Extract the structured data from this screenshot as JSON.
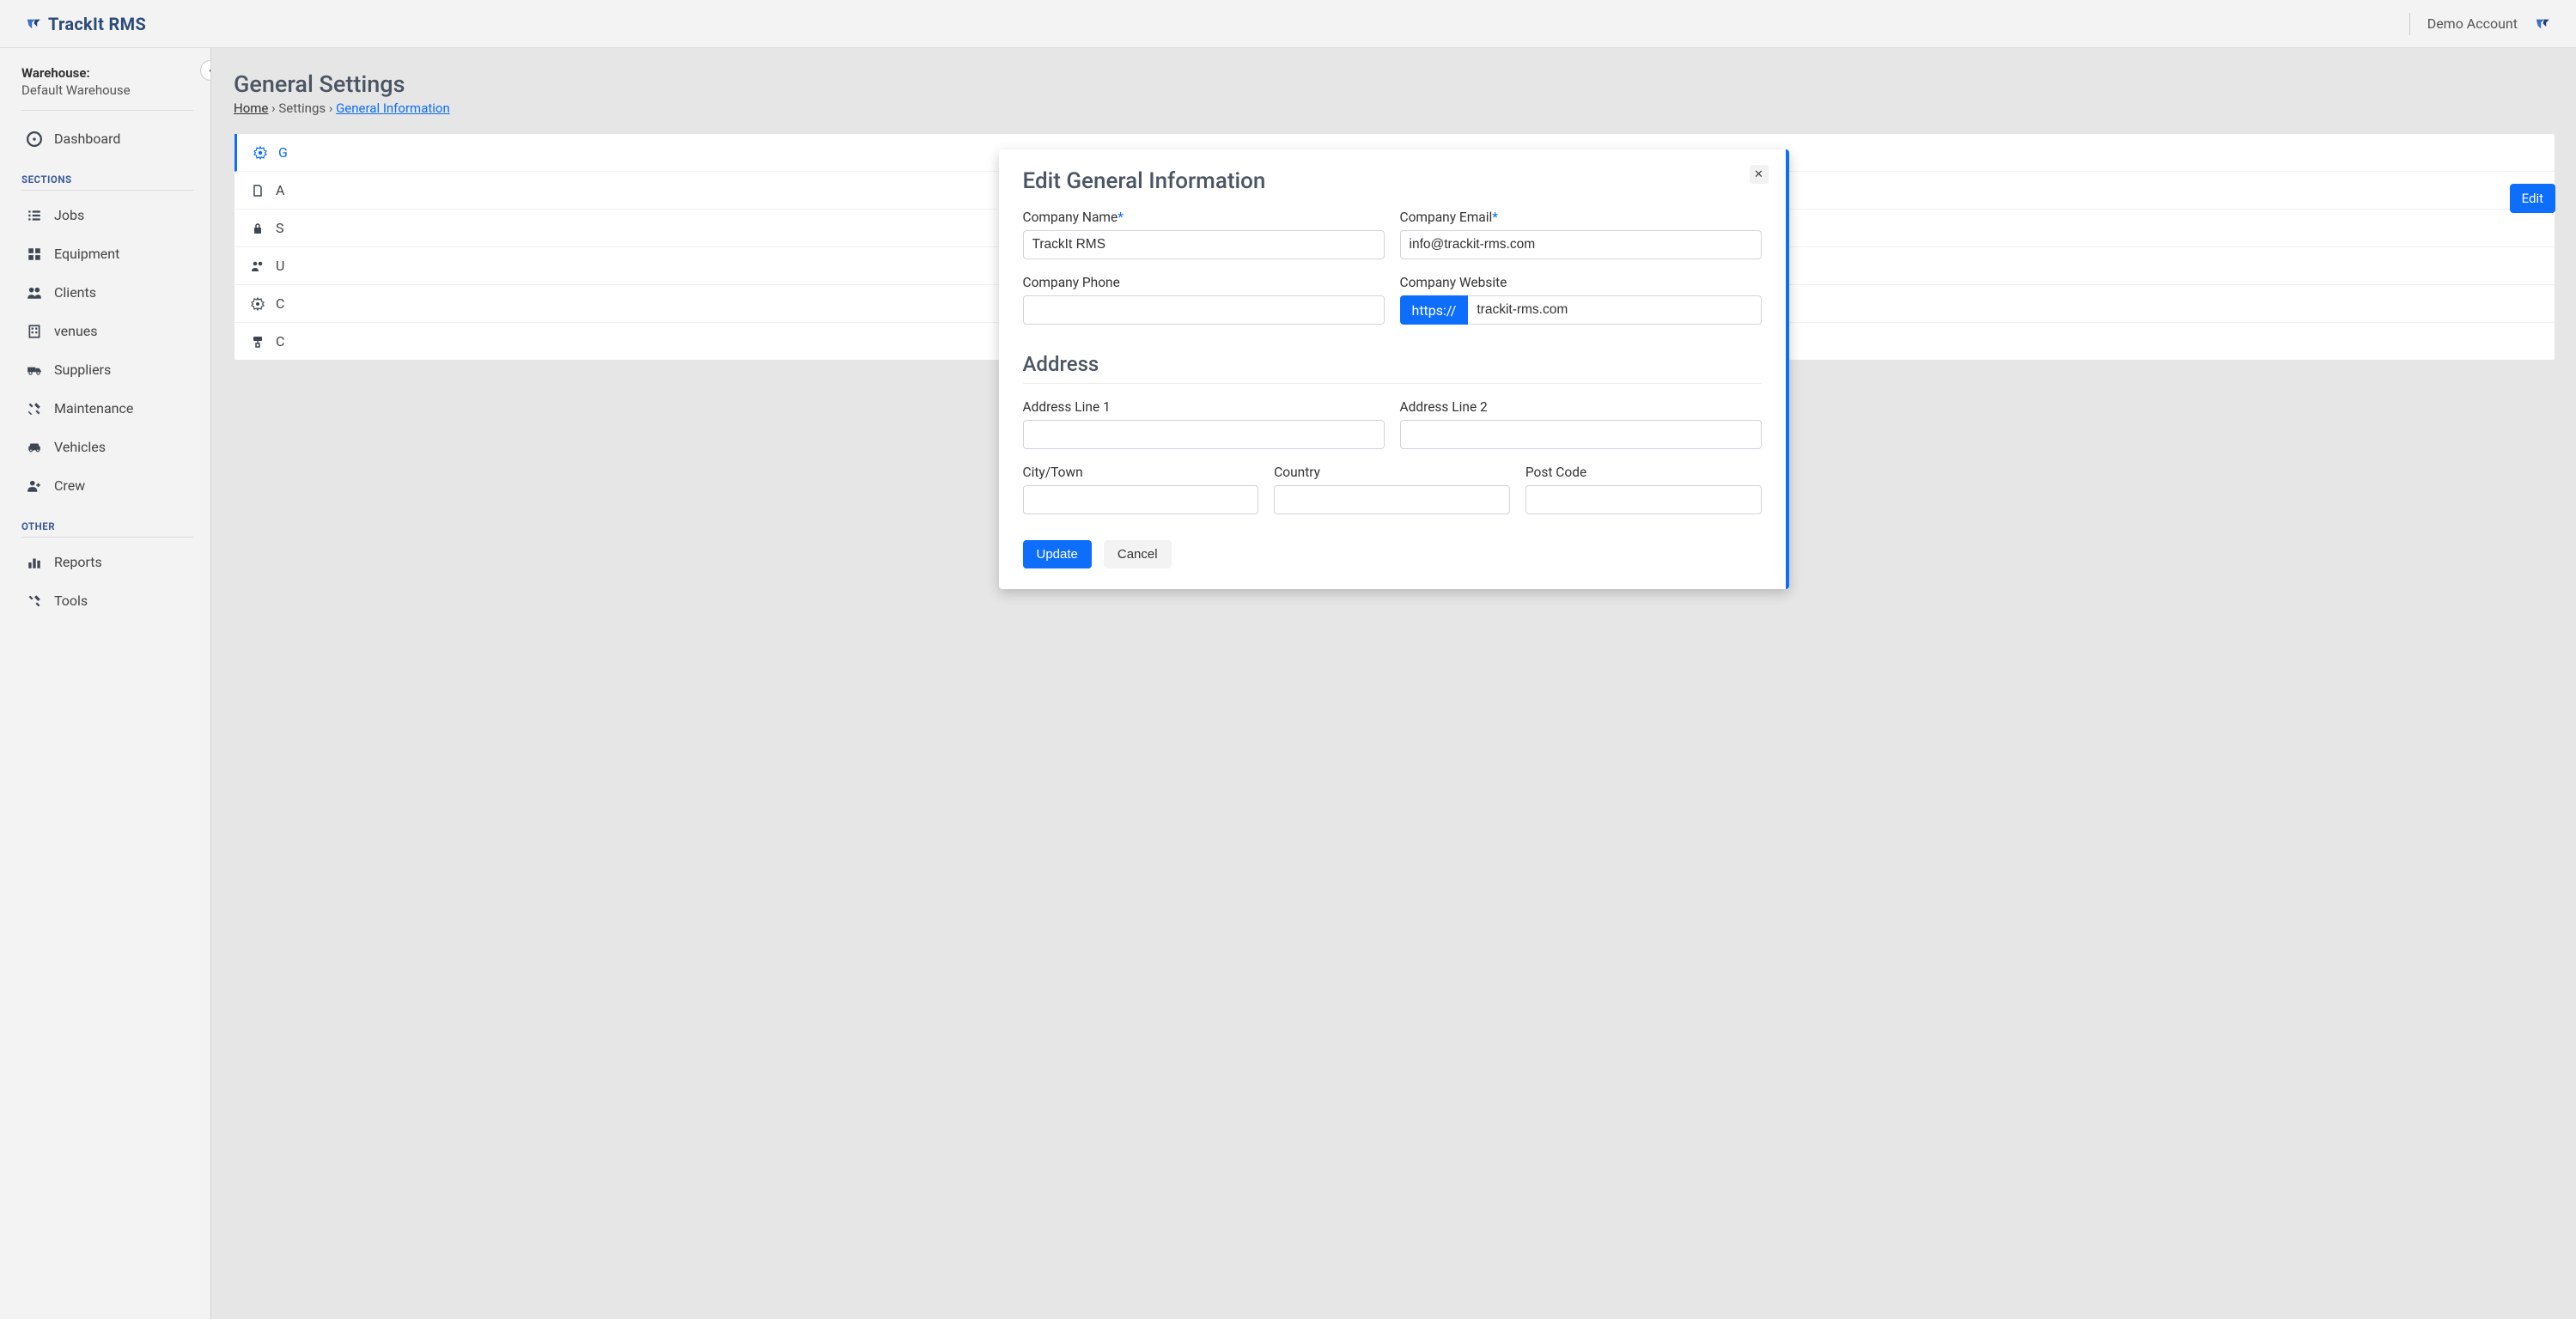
{
  "header": {
    "brand": "TrackIt RMS",
    "account": "Demo Account"
  },
  "sidebar": {
    "warehouse_label": "Warehouse:",
    "warehouse_value": "Default Warehouse",
    "items_main": [
      {
        "label": "Dashboard",
        "icon": "gauge"
      }
    ],
    "sections_heading": "Sections",
    "sections_items": [
      {
        "label": "Jobs",
        "icon": "list"
      },
      {
        "label": "Equipment",
        "icon": "boxes"
      },
      {
        "label": "Clients",
        "icon": "users"
      },
      {
        "label": "venues",
        "icon": "building"
      },
      {
        "label": "Suppliers",
        "icon": "truck"
      },
      {
        "label": "Maintenance",
        "icon": "wrench"
      },
      {
        "label": "Vehicles",
        "icon": "car"
      },
      {
        "label": "Crew",
        "icon": "user-plus"
      }
    ],
    "other_heading": "Other",
    "other_items": [
      {
        "label": "Reports",
        "icon": "chart-bar"
      },
      {
        "label": "Tools",
        "icon": "wrench-screw"
      }
    ]
  },
  "page": {
    "title": "General Settings",
    "breadcrumb": {
      "home": "Home",
      "settings": "Settings",
      "current": "General Information"
    },
    "edit_button": "Edit"
  },
  "settings_tabs": [
    {
      "label": "G",
      "icon": "gear",
      "active": true
    },
    {
      "label": "A",
      "icon": "file"
    },
    {
      "label": "S",
      "icon": "lock"
    },
    {
      "label": "U",
      "icon": "users"
    },
    {
      "label": "C",
      "icon": "gear"
    },
    {
      "label": "C",
      "icon": "paint"
    }
  ],
  "modal": {
    "title": "Edit General Information",
    "company_name_label": "Company Name",
    "company_name_value": "TrackIt RMS",
    "company_email_label": "Company Email",
    "company_email_value": "info@trackit-rms.com",
    "company_phone_label": "Company Phone",
    "company_phone_value": "",
    "company_website_label": "Company Website",
    "website_prefix": "https://",
    "website_value": "trackit-rms.com",
    "address_title": "Address",
    "address1_label": "Address Line 1",
    "address1_value": "",
    "address2_label": "Address Line 2",
    "address2_value": "",
    "city_label": "City/Town",
    "city_value": "",
    "country_label": "Country",
    "country_value": "",
    "postcode_label": "Post Code",
    "postcode_value": "",
    "update": "Update",
    "cancel": "Cancel"
  }
}
